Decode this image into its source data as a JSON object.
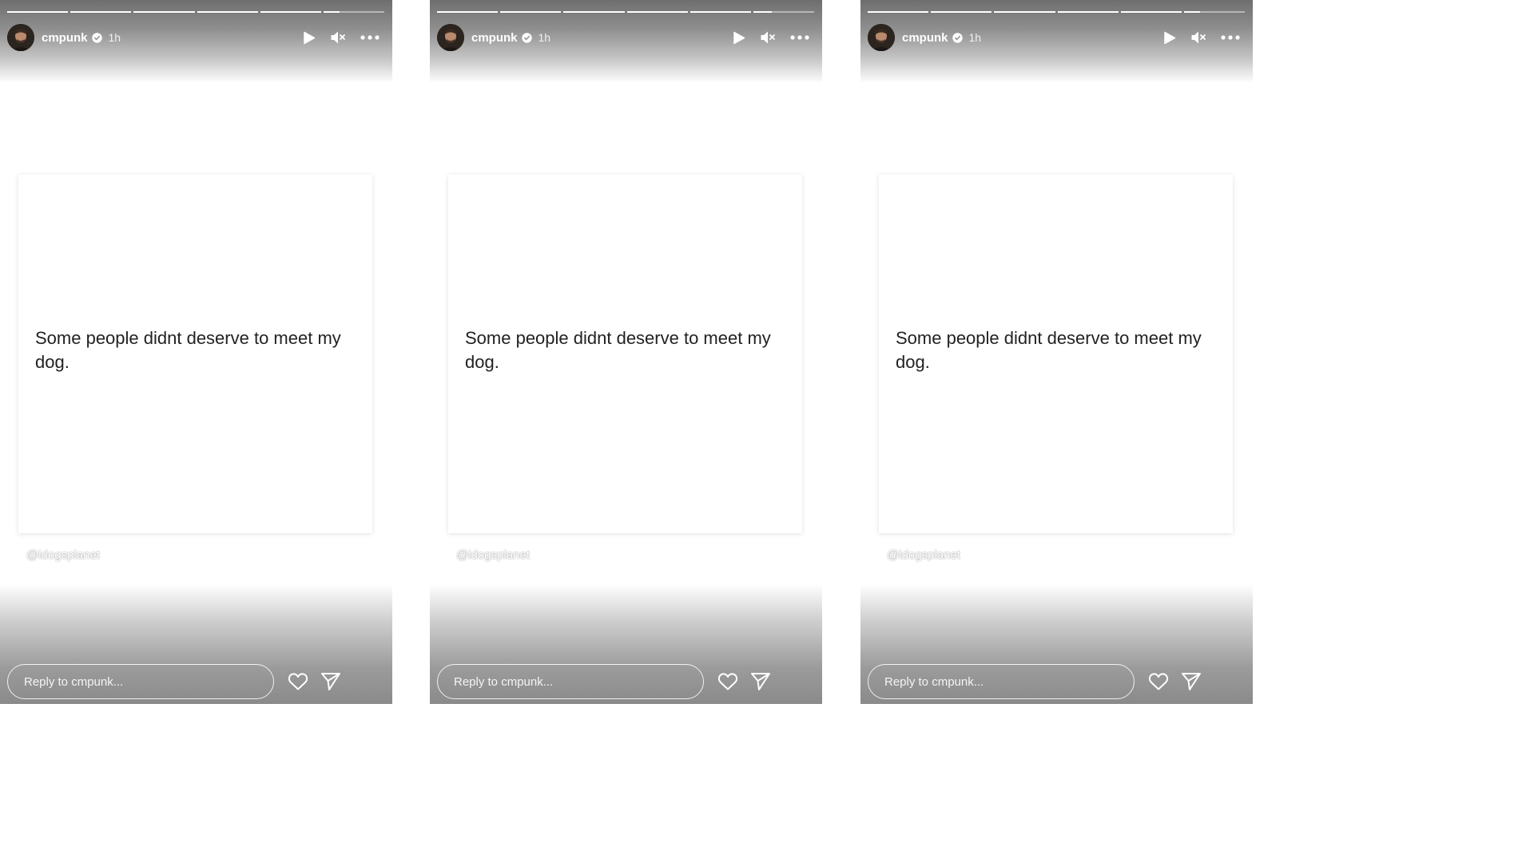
{
  "stories": [
    {
      "username": "cmpunk",
      "time": "1h",
      "progress": [
        1,
        1,
        1,
        1,
        1,
        0.27
      ],
      "post_text": "Some people didnt deserve to meet my dog.",
      "watermark": "@idogsplanet",
      "reply_placeholder": "Reply to cmpunk..."
    },
    {
      "username": "cmpunk",
      "time": "1h",
      "progress": [
        1,
        1,
        1,
        1,
        1,
        0.3
      ],
      "post_text": "Some people didnt deserve to meet my dog.",
      "watermark": "@idogsplanet",
      "reply_placeholder": "Reply to cmpunk..."
    },
    {
      "username": "cmpunk",
      "time": "1h",
      "progress": [
        1,
        1,
        1,
        1,
        1,
        0.27
      ],
      "post_text": "Some people didnt deserve to meet my dog.",
      "watermark": "@idogsplanet",
      "reply_placeholder": "Reply to cmpunk..."
    }
  ],
  "icons": {
    "verified": "verified-badge-icon",
    "play": "play-icon",
    "mute": "muted-speaker-icon",
    "more": "more-options-icon",
    "like": "heart-icon",
    "share": "send-icon"
  },
  "colors": {
    "overlay_gray": "#8a8a8a",
    "card_text": "#222222",
    "foreground": "#ffffff"
  }
}
